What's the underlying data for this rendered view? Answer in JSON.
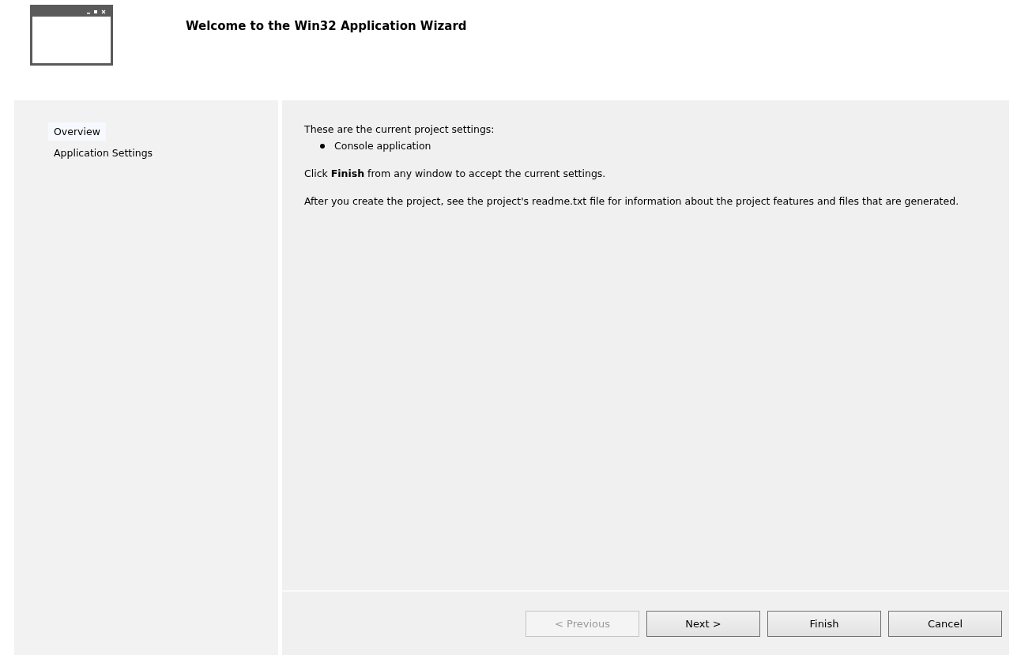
{
  "header": {
    "title": "Welcome to the Win32 Application Wizard"
  },
  "sidebar": {
    "items": [
      {
        "label": "Overview",
        "selected": true
      },
      {
        "label": "Application Settings",
        "selected": false
      }
    ]
  },
  "content": {
    "intro": "These are the current project settings:",
    "settings": [
      "Console application"
    ],
    "paragraphs": [
      "Click **Finish** from any window to accept the current settings.",
      "After you create the project, see the project's readme.txt file for information about the project features and files that are generated."
    ]
  },
  "buttons": [
    {
      "label": "< Previous",
      "disabled": true
    },
    {
      "label": "Next >",
      "disabled": false
    },
    {
      "label": "Finish",
      "disabled": false
    },
    {
      "label": "Cancel",
      "disabled": false
    }
  ]
}
